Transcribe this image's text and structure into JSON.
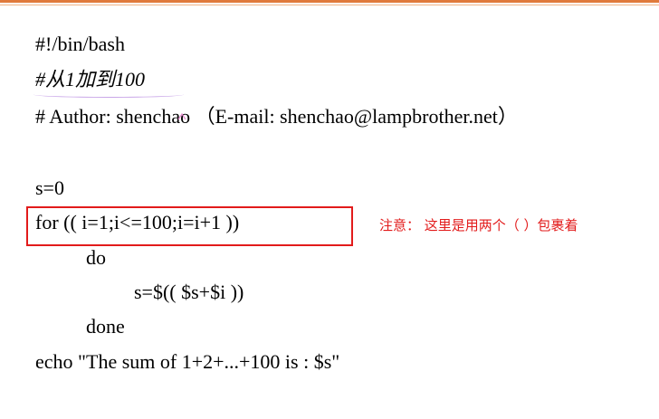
{
  "code_lines": [
    "#!/bin/bash",
    "#从1加到100",
    "# Author: shenchao （E-mail: shenchao@lampbrother.net）",
    "s=0",
    "for (( i=1;i<=100;i=i+1 ))",
    "do",
    "s=$(( $s+$i ))",
    "done",
    "echo \"The sum of 1+2+...+100 is : $s\""
  ],
  "annotation": "注意： 这里是用两个（ ）包裹着",
  "colors": {
    "accent_rule": "#e07a3c",
    "highlight_box": "#e21b1b",
    "annotation_text": "#e21b1b"
  }
}
